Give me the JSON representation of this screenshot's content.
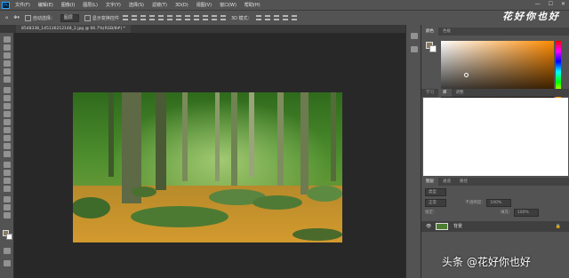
{
  "app": {
    "logo": "Ps"
  },
  "menu": [
    "文件(F)",
    "编辑(E)",
    "图像(I)",
    "图层(L)",
    "文字(Y)",
    "选择(S)",
    "滤镜(T)",
    "3D(D)",
    "视图(V)",
    "窗口(W)",
    "帮助(H)"
  ],
  "window_controls": {
    "minimize": "—",
    "maximize": "☐",
    "close": "✕"
  },
  "options": {
    "auto_select_label": "自动选择：",
    "auto_select_value": "图层",
    "transform_controls_label": "显示变换控件",
    "mode_3d": "3D 模式："
  },
  "brand_overlay": "花好你也好",
  "document": {
    "tab_label": "8548338_145136212148_2.jpg @ 66.7%(RGB/8#) *"
  },
  "panels": {
    "color_tabs": [
      "颜色",
      "色板"
    ],
    "library_tabs": [
      "学习",
      "库",
      "调整"
    ],
    "layers_tabs": [
      "图层",
      "通道",
      "路径"
    ],
    "layer_kind": "类型",
    "blend_mode": "正常",
    "opacity_label": "不透明度：",
    "opacity_value": "100%",
    "lock_label": "锁定：",
    "fill_label": "填充：",
    "fill_value": "100%",
    "layer_name": "背景"
  },
  "watermark": "头条 @花好你也好",
  "colors": {
    "accent": "#31a8ff",
    "fg_swatch": "#8a7b5e",
    "bg_swatch": "#ffffff"
  },
  "icons": [
    "move-icon",
    "marquee-icon",
    "lasso-icon",
    "magic-wand-icon",
    "crop-icon",
    "eyedropper-icon",
    "healing-icon",
    "brush-icon",
    "stamp-icon",
    "history-brush-icon",
    "eraser-icon",
    "gradient-icon",
    "blur-icon",
    "dodge-icon",
    "pen-icon",
    "type-icon",
    "path-select-icon",
    "shape-icon",
    "hand-icon",
    "zoom-icon"
  ]
}
